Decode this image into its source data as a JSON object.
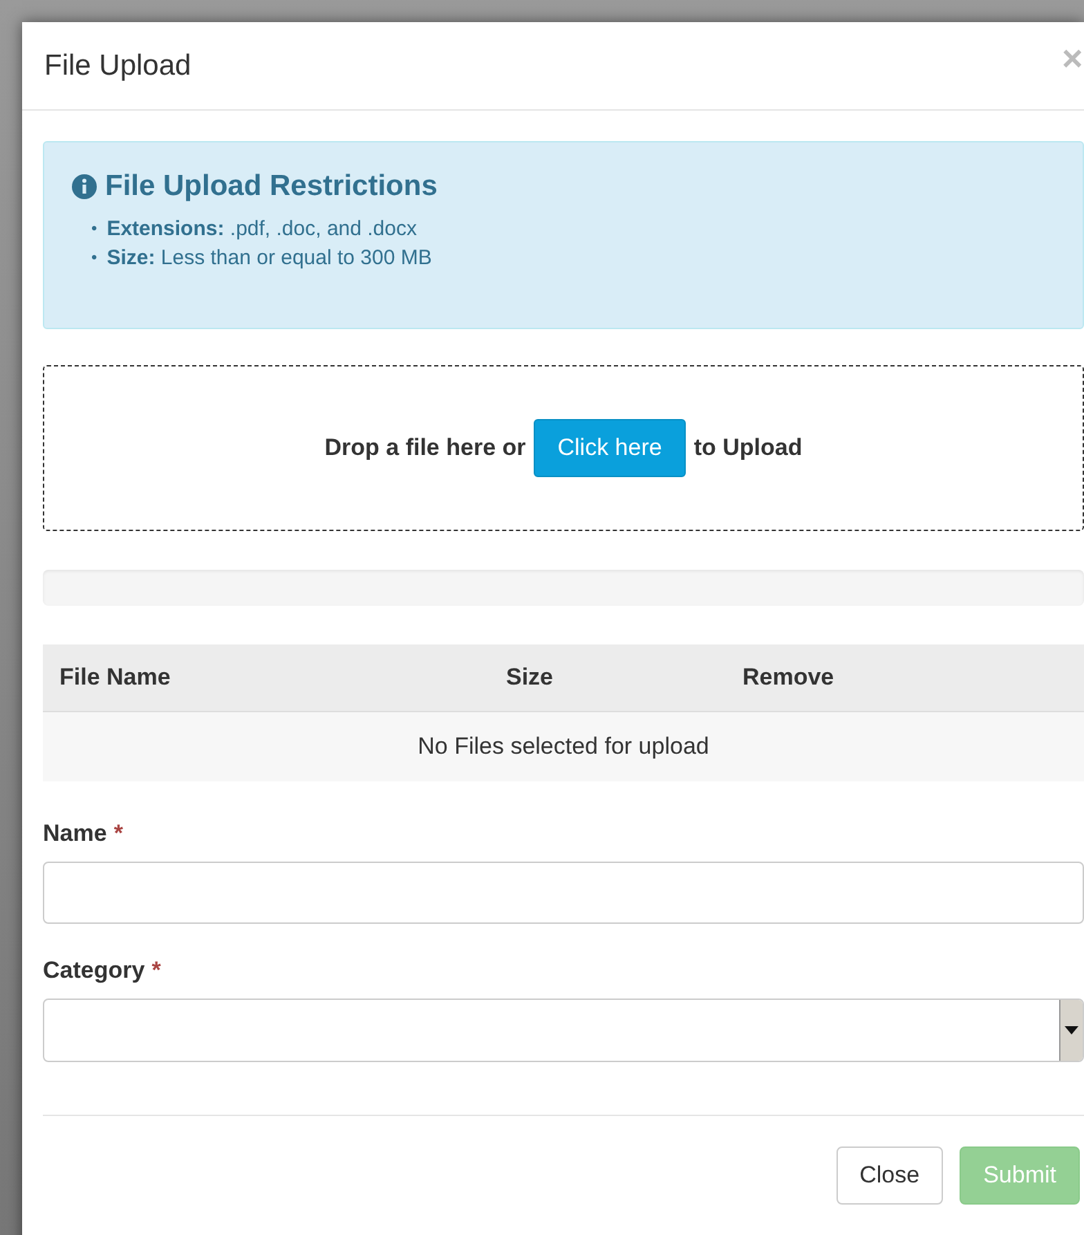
{
  "dialog": {
    "title": "File Upload",
    "close_icon": "×"
  },
  "restrictions": {
    "title": "File Upload Restrictions",
    "items": [
      {
        "bullet": "•",
        "label": "Extensions:",
        "text": ".pdf, .doc, and .docx"
      },
      {
        "bullet": "•",
        "label": "Size:",
        "text": "Less than or equal to 300 MB"
      }
    ]
  },
  "dropzone": {
    "before": "Drop a file here or",
    "button": "Click here",
    "after": "to Upload"
  },
  "progress": {
    "level": 0
  },
  "table": {
    "columns": [
      "File Name",
      "Size",
      "Remove"
    ],
    "empty_message": "No Files selected for upload"
  },
  "fields": [
    {
      "kind": "text",
      "label": "Name",
      "required_mark": "*"
    },
    {
      "kind": "select",
      "label": "Category",
      "required_mark": "*"
    }
  ],
  "buttons": [
    {
      "label": "Close",
      "kind": "default",
      "disabled": false
    },
    {
      "label": "Submit",
      "kind": "primary",
      "disabled": true
    }
  ]
}
